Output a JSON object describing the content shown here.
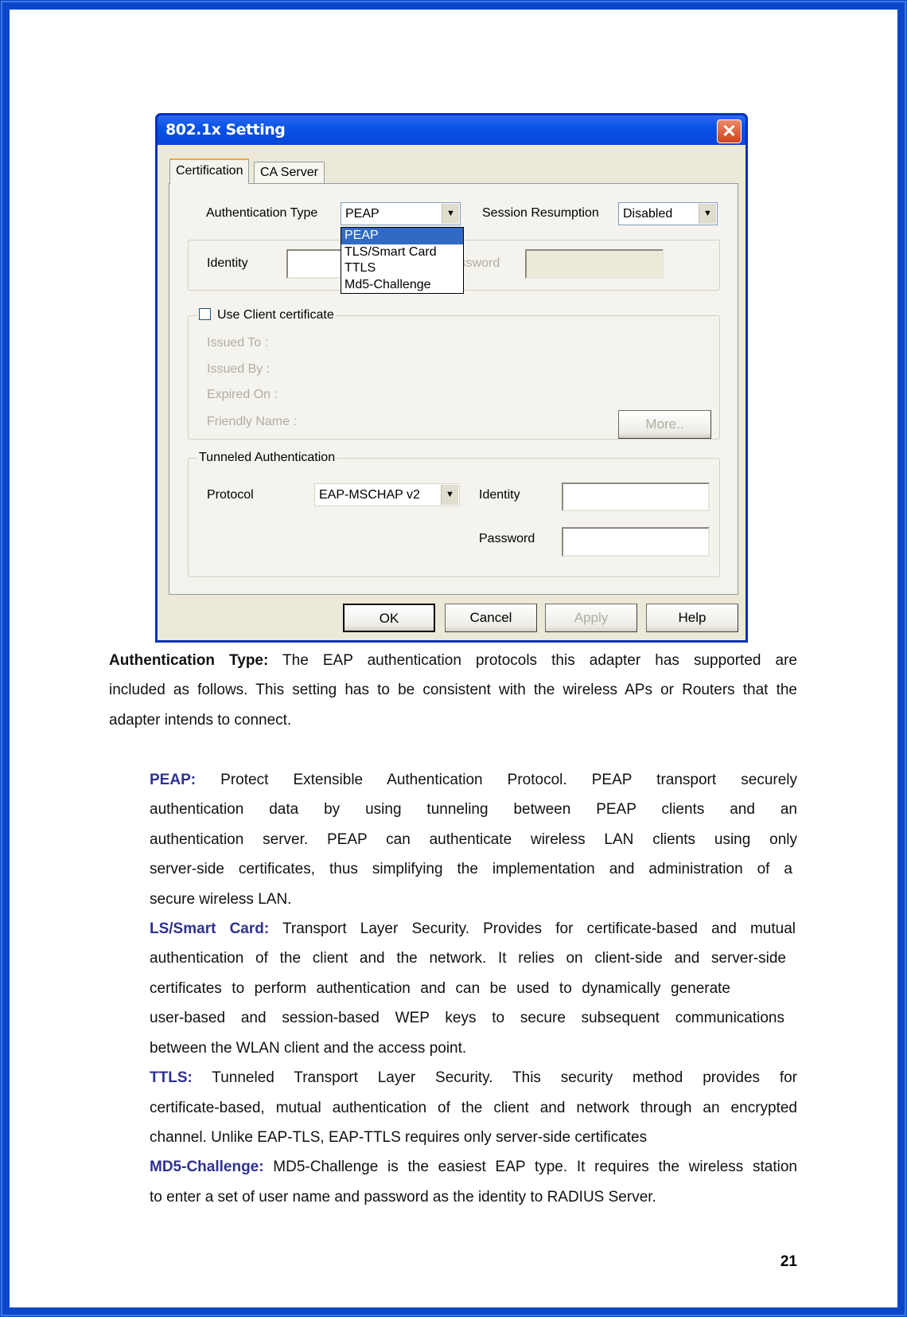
{
  "dialog": {
    "title": "802.1x Setting",
    "close_icon": "close-x-icon",
    "tabs": [
      {
        "label": "Certification",
        "active": true
      },
      {
        "label": "CA Server",
        "active": false
      }
    ],
    "auth_type": {
      "label": "Authentication Type",
      "value": "PEAP",
      "options": [
        "PEAP",
        "TLS/Smart Card",
        "TTLS",
        "Md5-Challenge"
      ],
      "highlighted": "PEAP"
    },
    "session_resumption": {
      "label": "Session Resumption",
      "value": "Disabled"
    },
    "identity": {
      "label": "Identity",
      "value": ""
    },
    "password": {
      "label": "Password",
      "value": ""
    },
    "client_cert": {
      "label": "Use Client certificate",
      "checked": false,
      "issued_to": "Issued To :",
      "issued_by": "Issued By :",
      "expired_on": "Expired On :",
      "friendly_name": "Friendly Name :",
      "more_label": "More.."
    },
    "tunneled": {
      "label": "Tunneled Authentication",
      "protocol_label": "Protocol",
      "protocol_value": "EAP-MSCHAP v2",
      "identity_label": "Identity",
      "password_label": "Password"
    },
    "buttons": {
      "ok": "OK",
      "cancel": "Cancel",
      "apply": "Apply",
      "help": "Help"
    }
  },
  "text": {
    "auth": {
      "key": "Authentication Type:",
      "lines": [
        " The EAP authentication protocols this adapter has supported are",
        "included as follows. This setting has to be consistent with the wireless APs or Routers that the",
        "adapter intends to connect."
      ]
    },
    "peap": {
      "key": "PEAP:",
      "lines": [
        " Protect Extensible Authentication Protocol. PEAP transport securely",
        "authentication data by using tunneling between PEAP clients and an",
        "authentication server. PEAP can authenticate wireless LAN clients using only",
        "server-side certificates, thus simplifying the implementation and administration of a",
        "secure wireless LAN."
      ]
    },
    "tls": {
      "key": "LS/Smart Card:",
      "lines": [
        " Transport Layer Security. Provides for certificate-based and mutual",
        "authentication of the client and the network. It relies on client-side and server-side",
        "certificates to perform authentication and can be used to dynamically generate",
        "user-based and session-based WEP keys to secure subsequent communications",
        "between the WLAN client and the access point."
      ]
    },
    "ttls": {
      "key": "TTLS:",
      "lines": [
        " Tunneled Transport Layer Security. This security method provides for",
        "certificate-based, mutual authentication of the client and network through an encrypted",
        "channel. Unlike EAP-TLS, EAP-TTLS requires only server-side certificates"
      ]
    },
    "md5": {
      "key": "MD5-Challenge:",
      "lines": [
        " MD5-Challenge is the easiest EAP type. It requires the wireless station",
        "to enter a set of user name and password as the identity to RADIUS Server."
      ]
    }
  },
  "page_number": "21",
  "colors": {
    "frame": "#0b47c9",
    "key_text": "#2e3192",
    "title_bar": "#0a52e6",
    "selection": "#316ac5"
  }
}
